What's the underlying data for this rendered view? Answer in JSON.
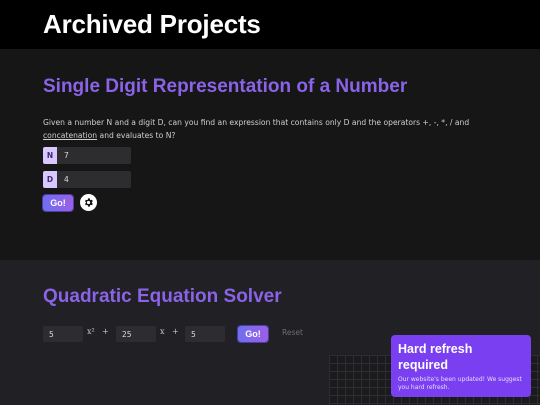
{
  "header": {
    "title": "Archived Projects"
  },
  "single_digit": {
    "title": "Single Digit Representation of a Number",
    "desc_pre": "Given a number N and a digit D, can you find an expression that contains only D and the operators +, -, *, / and ",
    "desc_link": "concatenation",
    "desc_post": " and evaluates to N?",
    "n_label": "N",
    "n_value": "7",
    "d_label": "D",
    "d_value": "4",
    "go_label": "Go!"
  },
  "quadratic": {
    "title": "Quadratic Equation Solver",
    "a_value": "5",
    "x2_symbol": "x²",
    "plus1": "+",
    "b_value": "25",
    "x_symbol": "x",
    "plus2": "+",
    "c_value": "5",
    "go_label": "Go!",
    "reset_label": "Reset"
  },
  "toast": {
    "title": "Hard refresh required",
    "message": "Our website's been updated! We suggest you hard refresh."
  },
  "colors": {
    "accent": "#8a63e6",
    "toast": "#7a3ff0",
    "tag": "#d9c7ff"
  },
  "icons": {
    "settings": "gear-icon"
  }
}
